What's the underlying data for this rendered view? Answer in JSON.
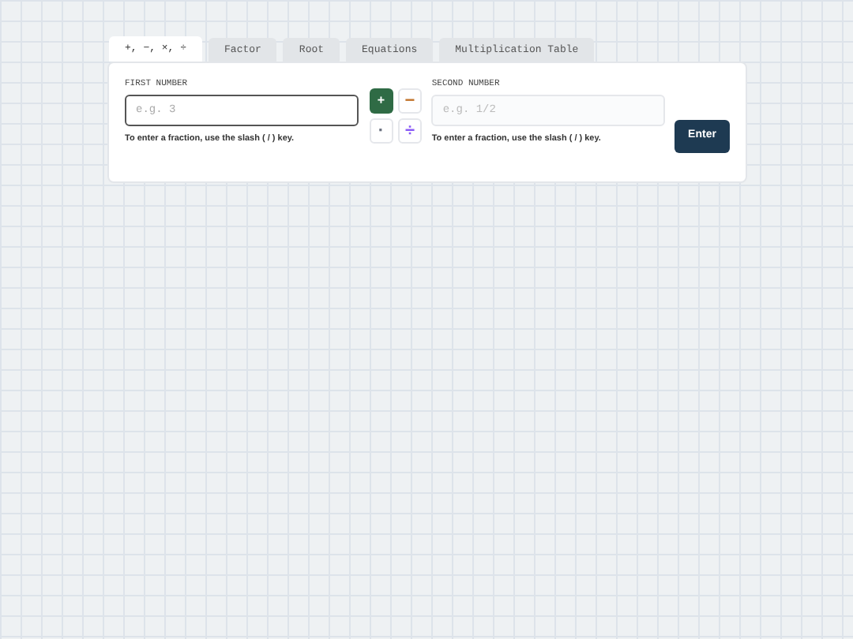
{
  "tabs": [
    {
      "label": "+, −, ×, ÷",
      "selected": true
    },
    {
      "label": "Factor",
      "selected": false
    },
    {
      "label": "Root",
      "selected": false
    },
    {
      "label": "Equations",
      "selected": false
    },
    {
      "label": "Multiplication Table",
      "selected": false
    }
  ],
  "first": {
    "label": "FIRST NUMBER",
    "placeholder": "e.g. 3",
    "focused": true,
    "hint": "To enter a fraction, use the slash ( / ) key."
  },
  "operators": [
    {
      "symbol": "+",
      "selected": true,
      "color": "#2f6b45"
    },
    {
      "symbol": "−",
      "selected": false,
      "color": "#c2742c"
    },
    {
      "symbol": "·",
      "selected": false,
      "color": "#6b7280"
    },
    {
      "symbol": "÷",
      "selected": false,
      "color": "#8b5cf6"
    }
  ],
  "second": {
    "label": "SECOND NUMBER",
    "placeholder": "e.g. 1/2",
    "focused": false,
    "hint": "To enter a fraction, use the slash ( / ) key."
  },
  "enter_button": "Enter"
}
